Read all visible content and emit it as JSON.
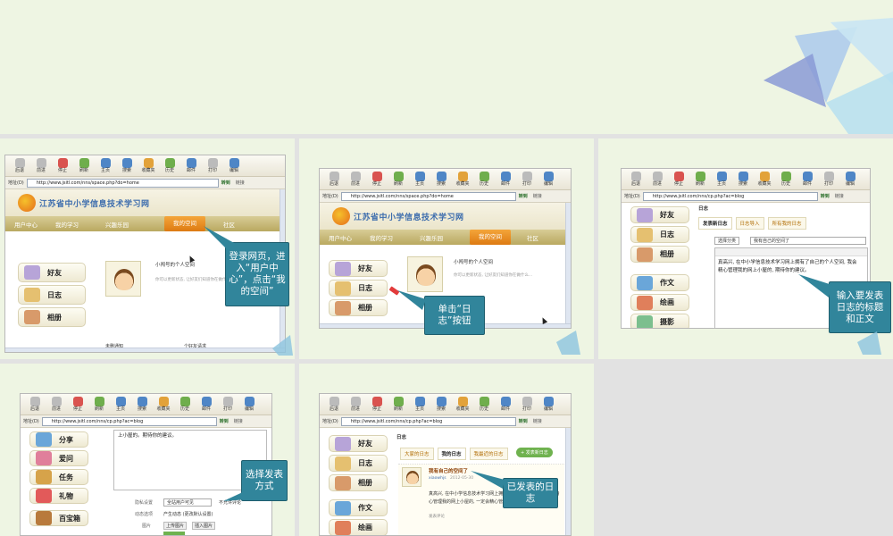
{
  "toolbar": {
    "back": "后退",
    "forward": "前进",
    "stop": "停止",
    "refresh": "刷新",
    "home": "主页",
    "search": "搜索",
    "favorites": "收藏夹",
    "history": "历史",
    "mail": "邮件",
    "print": "打印",
    "edit": "编辑"
  },
  "address": {
    "label": "地址(D)",
    "go": "转到",
    "links": "链接",
    "url_home": "http://www.jsitl.com/nns/space.php?do=home",
    "url_blog": "http://www.jsitl.com/nns/cp.php?ac=blog"
  },
  "site": {
    "title": "江苏省中小学信息技术学习网",
    "logo_sub": "jsitl.com",
    "nav": [
      "用户中心",
      "我的学习",
      "兴趣乐园",
      "我的空间",
      "社区"
    ],
    "space_title": "小闯号的个人空间",
    "status_hint": "你可以更新状态, 让好友们知道你在做什么...",
    "notice": "未删通知",
    "pending": "个好友请求"
  },
  "sidebar": {
    "friends": "好友",
    "diary": "日志",
    "album": "相册",
    "composition": "作文",
    "painting": "绘画",
    "photo": "摄影",
    "share": "分享",
    "heart": "爱问",
    "task": "任务",
    "gift": "礼物",
    "treasure": "百宝箱"
  },
  "diary_editor": {
    "heading": "日志",
    "tabs": [
      "发表新日志",
      "日志导入",
      "所有我的日志"
    ],
    "category": "选择分类",
    "title_value": "我有自己的空间了",
    "body_value": "真高兴, 在中小学信息技术学习网上拥有了自己的个人空间, 我会精心管理我的网上小屋的, 期待你的建议。",
    "body_line2": "上小屋的。期待你的建议。",
    "privacy_label": "隐私设置",
    "privacy_value": "全站用户可见",
    "no_comment": "不允许评论",
    "dynamic_label": "动态选项",
    "dynamic_value": "产生动态 (更改默认设置)",
    "picture_label": "图片",
    "upload": "上传图片",
    "insert": "插入图片"
  },
  "diary_list": {
    "heading": "日志",
    "tabs": [
      "大家的日志",
      "我的日志",
      "我最近的日志"
    ],
    "new_button": "+ 发表新日志",
    "post_title": "我有自己的空间了",
    "post_author": "xiaowhjs",
    "post_date": "2012-05-30",
    "post_body": "真高兴, 在中小学信息技术学习网上拥有了自己的个人空间, 我会精心管理我的网上小屋的, 一定会精心管理我的网上小屋的",
    "comment": "发表评论"
  },
  "callouts": {
    "c1": "登录网页，进入“用户中心”，点击“我的空间”",
    "c2": "单击“日志”按钮",
    "c3": "输入要发表日志的标题和正文",
    "c4": "选择发表方式",
    "c5": "已发表的日志"
  },
  "colors": {
    "callout_bg": "#31859b",
    "page_bg": "#eef5e3",
    "nav_active": "#e8891f"
  }
}
